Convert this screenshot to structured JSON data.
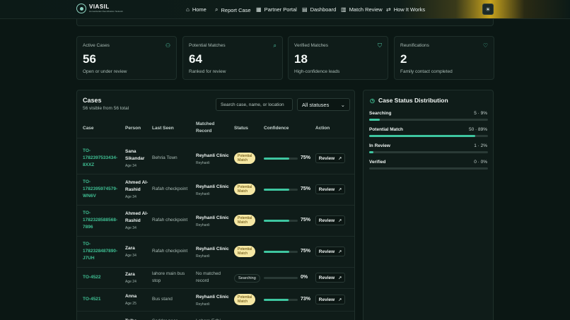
{
  "brand": {
    "name": "VIASIL",
    "tagline": "Humanitarian Reunification Network"
  },
  "nav": [
    {
      "label": "Home",
      "icon": "home-icon",
      "glyph": "⌂"
    },
    {
      "label": "Report Case",
      "icon": "search-icon",
      "glyph": "⌕"
    },
    {
      "label": "Partner Portal",
      "icon": "building-icon",
      "glyph": "▦"
    },
    {
      "label": "Dashboard",
      "icon": "document-icon",
      "glyph": "▤"
    },
    {
      "label": "Match Review",
      "icon": "chart-icon",
      "glyph": "▥"
    },
    {
      "label": "How It Works",
      "icon": "workflow-icon",
      "glyph": "⇄"
    }
  ],
  "theme_toggle": {
    "icon": "sun-icon",
    "glyph": "☀"
  },
  "stats": [
    {
      "label": "Active Cases",
      "value": "56",
      "sub": "Open or under review",
      "icon": "users-icon",
      "glyph": "⚇"
    },
    {
      "label": "Potential Matches",
      "value": "64",
      "sub": "Ranked for review",
      "icon": "search-icon",
      "glyph": "⌕"
    },
    {
      "label": "Verified Matches",
      "value": "18",
      "sub": "High-confidence leads",
      "icon": "shield-check-icon",
      "glyph": "⛉"
    },
    {
      "label": "Reunifications",
      "value": "2",
      "sub": "Family contact completed",
      "icon": "heart-icon",
      "glyph": "♡"
    }
  ],
  "cases": {
    "title": "Cases",
    "subtitle": "56 visible from 56 total",
    "search_placeholder": "Search case, name, or location",
    "status_filter": "All statuses",
    "columns": {
      "case": "Case",
      "person": "Person",
      "last_seen": "Last Seen",
      "matched_record": [
        "Matched",
        "Record"
      ],
      "status": "Status",
      "confidence": "Confidence",
      "action": "Action"
    },
    "rows": [
      {
        "id": [
          "TO-",
          "1782397533434-",
          "8XXZ"
        ],
        "person": [
          "Sana",
          "Sikandar"
        ],
        "age": "Age 34",
        "last_seen": [
          "Behria Town"
        ],
        "record": [
          "Reyhanli Clinic"
        ],
        "record_sub": "Reyhanli",
        "status": [
          "Potential",
          "Match"
        ],
        "status_kind": "pm",
        "confidence": 75,
        "confidence_label": "75%",
        "action": "Review"
      },
      {
        "id": [
          "TO-",
          "1782395974579-",
          "WN6V"
        ],
        "person": [
          "Ahmed Al-",
          "Rashid"
        ],
        "age": "Age 34",
        "last_seen": [
          "Rafah checkpoint"
        ],
        "record": [
          "Reyhanli Clinic"
        ],
        "record_sub": "Reyhanli",
        "status": [
          "Potential",
          "Match"
        ],
        "status_kind": "pm",
        "confidence": 75,
        "confidence_label": "75%",
        "action": "Review"
      },
      {
        "id": [
          "TO-",
          "1782328588568-",
          "7896"
        ],
        "person": [
          "Ahmed Al-",
          "Rashid"
        ],
        "age": "Age 34",
        "last_seen": [
          "Rafah checkpoint"
        ],
        "record": [
          "Reyhanli Clinic"
        ],
        "record_sub": "Reyhanli",
        "status": [
          "Potential",
          "Match"
        ],
        "status_kind": "pm",
        "confidence": 75,
        "confidence_label": "75%",
        "action": "Review"
      },
      {
        "id": [
          "TO-",
          "1782328487890-",
          "J7UH"
        ],
        "person": [
          "Zara"
        ],
        "age": "Age 34",
        "last_seen": [
          "Rafah checkpoint"
        ],
        "record": [
          "Reyhanli Clinic"
        ],
        "record_sub": "Reyhanli",
        "status": [
          "Potential",
          "Match"
        ],
        "status_kind": "pm",
        "confidence": 75,
        "confidence_label": "75%",
        "action": "Review"
      },
      {
        "id": [
          "TO-4522"
        ],
        "person": [
          "Zara"
        ],
        "age": "Age 24",
        "last_seen": [
          "lahore main bus",
          "stop"
        ],
        "record": [
          "No matched",
          "record"
        ],
        "record_sub": "",
        "status": [
          "Searching"
        ],
        "status_kind": "se",
        "confidence": 0,
        "confidence_label": "0%",
        "action": "Review"
      },
      {
        "id": [
          "TO-4521"
        ],
        "person": [
          "Anna"
        ],
        "age": "Age 25",
        "last_seen": [
          "Bus stand"
        ],
        "record": [
          "Reyhanli Clinic"
        ],
        "record_sub": "Reyhanli",
        "status": [
          "Potential",
          "Match"
        ],
        "status_kind": "pm",
        "confidence": 73,
        "confidence_label": "73%",
        "action": "Review"
      },
      {
        "id": [
          ""
        ],
        "person": [
          "Talha"
        ],
        "age": "",
        "last_seen": [
          "Saddar near"
        ],
        "record": [
          "Lahore Edhi"
        ],
        "record_sub": "",
        "status": [
          ""
        ],
        "status_kind": "none",
        "confidence": null,
        "confidence_label": "",
        "action": ""
      }
    ]
  },
  "distribution": {
    "title": "Case Status Distribution",
    "icon": "clock-icon",
    "glyph": "◷",
    "items": [
      {
        "label": "Searching",
        "count": "5 · 9%",
        "pct": 9
      },
      {
        "label": "Potential Match",
        "count": "50 · 89%",
        "pct": 89
      },
      {
        "label": "In Review",
        "count": "1 · 2%",
        "pct": 2
      },
      {
        "label": "Verified",
        "count": "0 · 0%",
        "pct": 0
      }
    ]
  }
}
